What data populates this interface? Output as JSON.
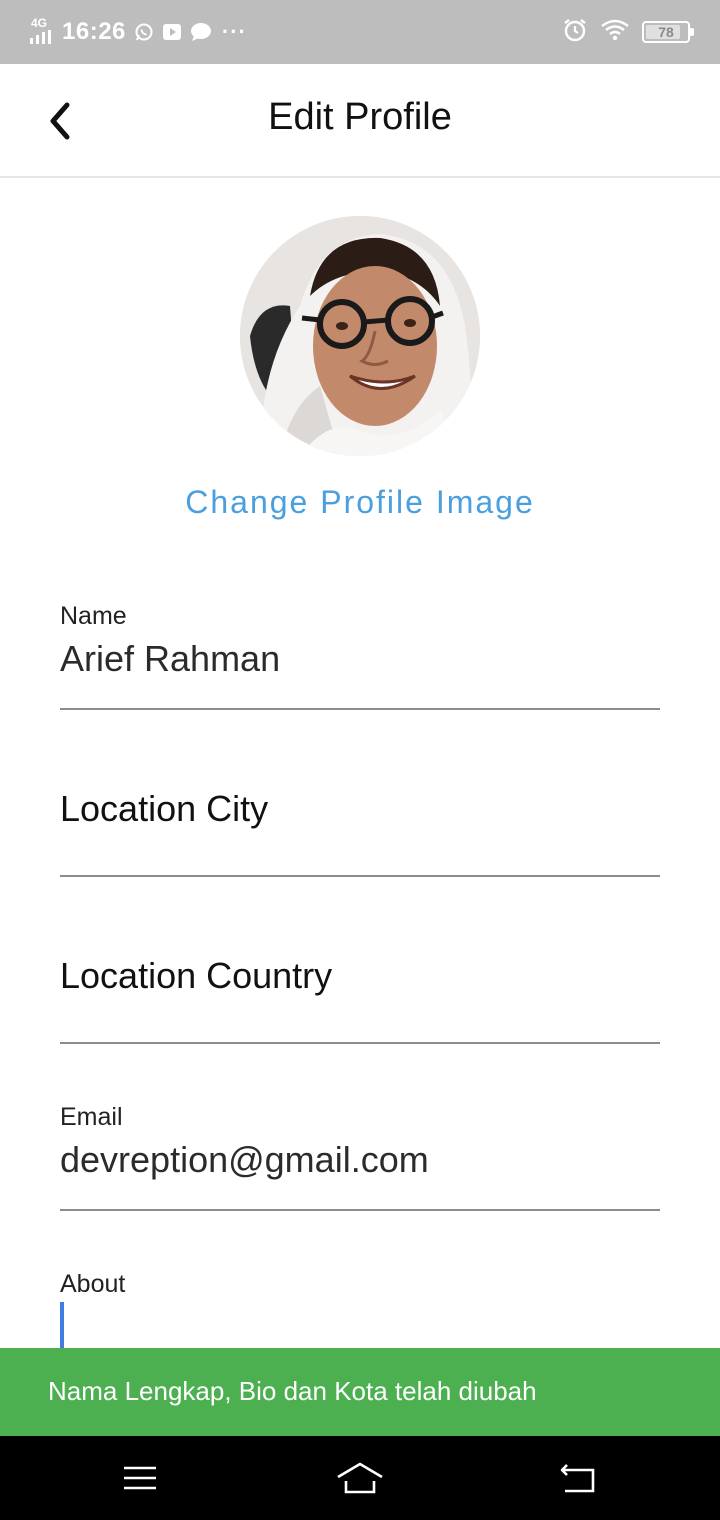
{
  "status_bar": {
    "network": "4G",
    "time": "16:26",
    "battery_level": "78",
    "icons": [
      "signal-icon",
      "whatsapp-icon",
      "youtube-icon",
      "message-icon",
      "more-icon",
      "alarm-icon",
      "wifi-icon",
      "battery-icon"
    ]
  },
  "app_bar": {
    "title": "Edit Profile",
    "back_icon": "chevron-left-icon"
  },
  "profile": {
    "change_image_label": "Change Profile Image",
    "link_color": "#4a9fde"
  },
  "form": {
    "name": {
      "label": "Name",
      "value": "Arief Rahman"
    },
    "city": {
      "placeholder": "Location City"
    },
    "country": {
      "placeholder": "Location Country"
    },
    "email": {
      "label": "Email",
      "value": "devreption@gmail.com"
    },
    "about": {
      "label": "About",
      "value": ""
    }
  },
  "snackbar": {
    "message": "Nama Lengkap, Bio dan Kota telah diubah",
    "color": "#4caf50"
  },
  "nav_bar": {
    "icons": [
      "menu-icon",
      "home-icon",
      "back-icon"
    ]
  }
}
